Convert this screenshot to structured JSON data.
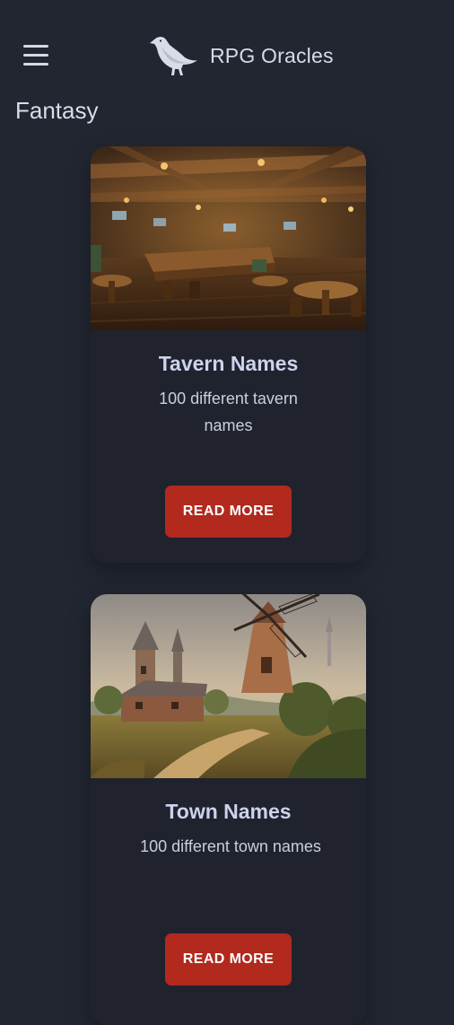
{
  "header": {
    "menu_icon": "hamburger-menu-icon",
    "logo_icon": "raven-icon",
    "title": "RPG Oracles"
  },
  "section": {
    "title": "Fantasy"
  },
  "cards": [
    {
      "image": "tavern-interior-image",
      "title": "Tavern Names",
      "description": "100 different tavern names",
      "button_label": "READ MORE"
    },
    {
      "image": "windmill-village-image",
      "title": "Town Names",
      "description": "100 different town names",
      "button_label": "READ MORE"
    }
  ],
  "colors": {
    "background": "#212631",
    "card": "#20232d",
    "button": "#b2291e",
    "card_title": "#cdd2ee"
  }
}
